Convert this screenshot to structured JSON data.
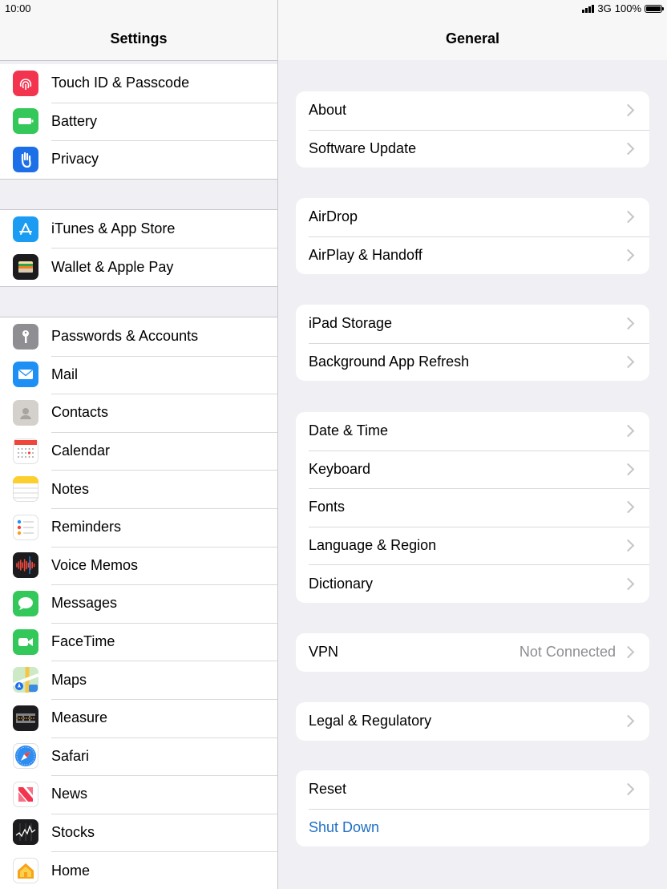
{
  "status": {
    "time": "10:00",
    "network": "3G",
    "battery": "100%"
  },
  "master": {
    "title": "Settings",
    "groups": [
      [
        {
          "label": "Touch ID & Passcode",
          "icon": "fingerprint-icon",
          "color": "#f2344f"
        },
        {
          "label": "Battery",
          "icon": "battery-icon",
          "color": "#34c759"
        },
        {
          "label": "Privacy",
          "icon": "hand-icon",
          "color": "#1d6fe8"
        }
      ],
      [
        {
          "label": "iTunes & App Store",
          "icon": "app-store-icon",
          "color": "#1a9cf3"
        },
        {
          "label": "Wallet & Apple Pay",
          "icon": "wallet-icon",
          "color": "#1c1c1e"
        }
      ],
      [
        {
          "label": "Passwords & Accounts",
          "icon": "key-icon",
          "color": "#8e8e93"
        },
        {
          "label": "Mail",
          "icon": "mail-icon",
          "color": "#1e90f5"
        },
        {
          "label": "Contacts",
          "icon": "contacts-icon",
          "color": "#d4d1cc"
        },
        {
          "label": "Calendar",
          "icon": "calendar-icon",
          "color": "#ffffff"
        },
        {
          "label": "Notes",
          "icon": "notes-icon",
          "color": "#ffffff"
        },
        {
          "label": "Reminders",
          "icon": "reminders-icon",
          "color": "#ffffff"
        },
        {
          "label": "Voice Memos",
          "icon": "voice-memos-icon",
          "color": "#1c1c1e"
        },
        {
          "label": "Messages",
          "icon": "messages-icon",
          "color": "#34c759"
        },
        {
          "label": "FaceTime",
          "icon": "facetime-icon",
          "color": "#34c759"
        },
        {
          "label": "Maps",
          "icon": "maps-icon",
          "color": "#cde9c6"
        },
        {
          "label": "Measure",
          "icon": "measure-icon",
          "color": "#1c1c1e"
        },
        {
          "label": "Safari",
          "icon": "safari-icon",
          "color": "#ffffff"
        },
        {
          "label": "News",
          "icon": "news-icon",
          "color": "#ffffff"
        },
        {
          "label": "Stocks",
          "icon": "stocks-icon",
          "color": "#1c1c1e"
        },
        {
          "label": "Home",
          "icon": "home-icon",
          "color": "#ffffff"
        }
      ]
    ]
  },
  "detail": {
    "title": "General",
    "groups": [
      [
        {
          "label": "About"
        },
        {
          "label": "Software Update"
        }
      ],
      [
        {
          "label": "AirDrop"
        },
        {
          "label": "AirPlay & Handoff"
        }
      ],
      [
        {
          "label": "iPad Storage"
        },
        {
          "label": "Background App Refresh"
        }
      ],
      [
        {
          "label": "Date & Time"
        },
        {
          "label": "Keyboard"
        },
        {
          "label": "Fonts"
        },
        {
          "label": "Language & Region"
        },
        {
          "label": "Dictionary"
        }
      ],
      [
        {
          "label": "VPN",
          "value": "Not Connected"
        }
      ],
      [
        {
          "label": "Legal & Regulatory"
        }
      ],
      [
        {
          "label": "Reset"
        },
        {
          "label": "Shut Down",
          "link": true
        }
      ]
    ]
  },
  "colors": {
    "link": "#1f6fc4",
    "background": "#efeff4"
  }
}
